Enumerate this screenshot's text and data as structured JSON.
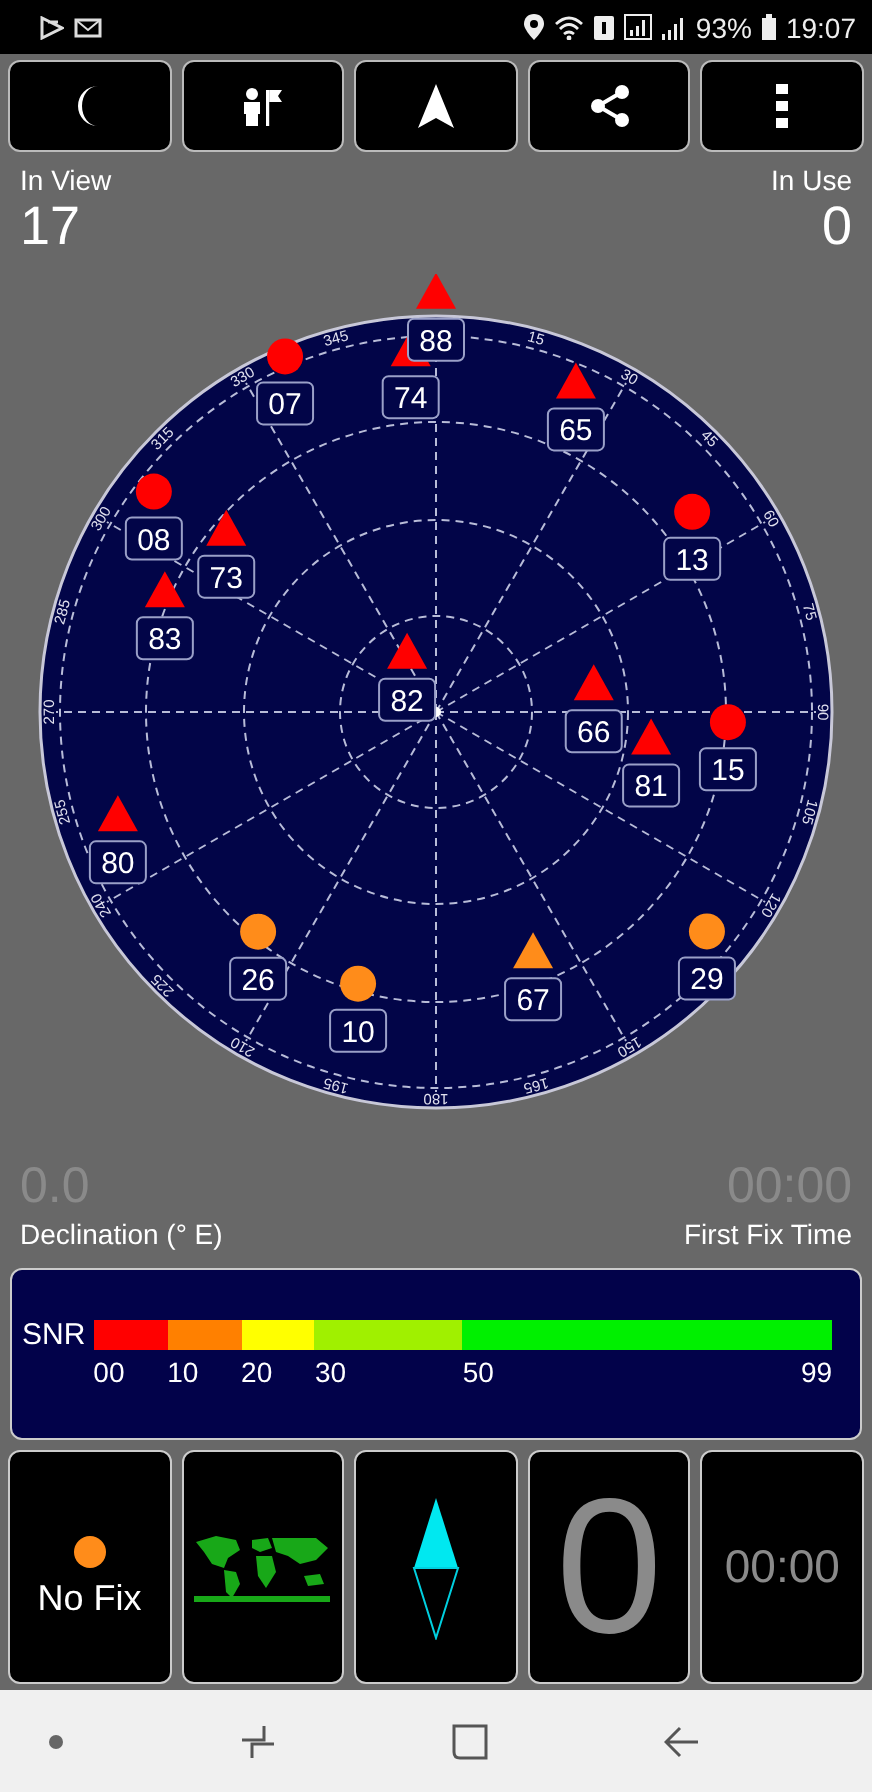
{
  "status_bar": {
    "battery": "93%",
    "time": "19:07"
  },
  "toolbar": [
    {
      "kind": "night"
    },
    {
      "kind": "person"
    },
    {
      "kind": "navigate"
    },
    {
      "kind": "share"
    },
    {
      "kind": "more"
    }
  ],
  "in_view": {
    "label": "In View",
    "value": "17"
  },
  "in_use": {
    "label": "In Use",
    "value": "0"
  },
  "sky_plot": {
    "azimuth_labels": [
      "345",
      "15",
      "30",
      "45",
      "60",
      "75",
      "90",
      "105",
      "120",
      "150",
      "165",
      "180",
      "195",
      "210",
      "225",
      "240",
      "255",
      "270",
      "285",
      "300",
      "315",
      "330"
    ],
    "satellites": [
      {
        "id": "74",
        "kind": "triangle",
        "color": "#ff0000"
      },
      {
        "id": "07",
        "kind": "circle",
        "color": "#ff0000"
      },
      {
        "id": "65",
        "kind": "triangle",
        "color": "#ff0000"
      },
      {
        "id": "08",
        "kind": "circle",
        "color": "#ff0000"
      },
      {
        "id": "73",
        "kind": "triangle",
        "color": "#ff0000"
      },
      {
        "id": "83",
        "kind": "triangle",
        "color": "#ff0000"
      },
      {
        "id": "13",
        "kind": "circle",
        "color": "#ff0000"
      },
      {
        "id": "82",
        "kind": "triangle",
        "color": "#ff0000"
      },
      {
        "id": "66",
        "kind": "triangle",
        "color": "#ff0000"
      },
      {
        "id": "81",
        "kind": "triangle",
        "color": "#ff0000"
      },
      {
        "id": "15",
        "kind": "circle",
        "color": "#ff0000"
      },
      {
        "id": "80",
        "kind": "triangle",
        "color": "#ff0000"
      },
      {
        "id": "26",
        "kind": "circle",
        "color": "#ff8c1a"
      },
      {
        "id": "10",
        "kind": "circle",
        "color": "#ff8c1a"
      },
      {
        "id": "67",
        "kind": "triangle",
        "color": "#ff8c1a"
      },
      {
        "id": "29",
        "kind": "circle",
        "color": "#ff8c1a"
      },
      {
        "id": "88",
        "kind": "triangle",
        "color": "#ff0000"
      }
    ]
  },
  "declination": {
    "value": "0.0",
    "label": "Declination (° E)"
  },
  "first_fix": {
    "value": "00:00",
    "label": "First Fix Time"
  },
  "snr": {
    "label": "SNR",
    "segments": [
      {
        "color": "#ff0000"
      },
      {
        "color": "#ff8000"
      },
      {
        "color": "#ffff00"
      },
      {
        "color": "#a0f000"
      },
      {
        "color": "#00f000"
      }
    ],
    "ticks": [
      "00",
      "10",
      "20",
      "30",
      "50",
      "99"
    ]
  },
  "tiles": [
    {
      "kind": "fix",
      "label": "No Fix",
      "color": "#ff8c1a"
    },
    {
      "kind": "map"
    },
    {
      "kind": "compass"
    },
    {
      "kind": "count",
      "value": "0"
    },
    {
      "kind": "timer",
      "value": "00:00"
    }
  ]
}
